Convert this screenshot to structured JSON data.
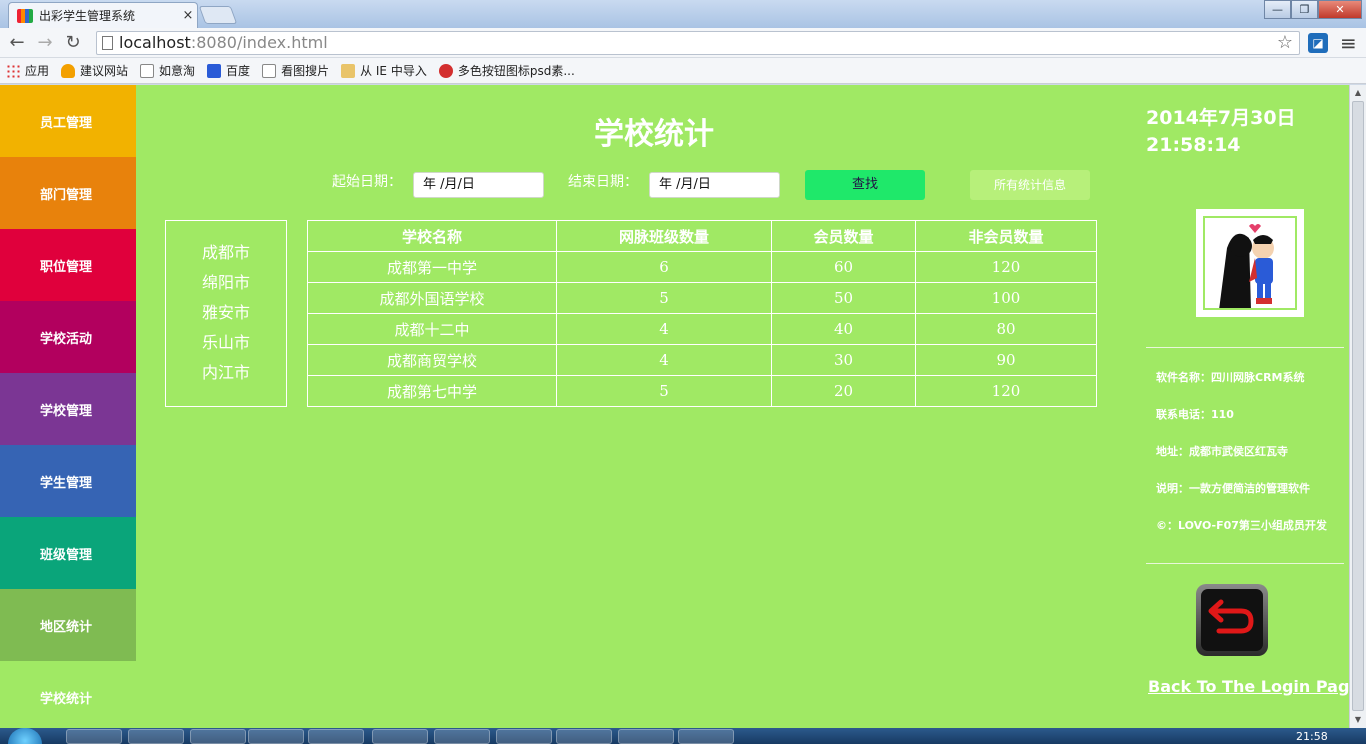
{
  "browser": {
    "tab_title": "出彩学生管理系统",
    "tab_close": "×",
    "url_host": "localhost",
    "url_path": ":8080/index.html",
    "window_controls": [
      "—",
      "❐",
      "✕"
    ]
  },
  "bookmarks": [
    {
      "label": "应用",
      "icon": "apps-icon"
    },
    {
      "label": "建议网站",
      "icon": "bulb-icon"
    },
    {
      "label": "如意淘",
      "icon": "page-icon"
    },
    {
      "label": "百度",
      "icon": "paw-icon"
    },
    {
      "label": "看图搜片",
      "icon": "page-icon"
    },
    {
      "label": "从 IE 中导入",
      "icon": "folder-icon"
    },
    {
      "label": "多色按钮图标psd素...",
      "icon": "red-badge-icon"
    }
  ],
  "sidebar": {
    "items": [
      {
        "label": "员工管理",
        "color": "#f2b200"
      },
      {
        "label": "部门管理",
        "color": "#e8820c"
      },
      {
        "label": "职位管理",
        "color": "#e0003c"
      },
      {
        "label": "学校活动",
        "color": "#b2005e"
      },
      {
        "label": "学校管理",
        "color": "#7b3694"
      },
      {
        "label": "学生管理",
        "color": "#3664b4"
      },
      {
        "label": "班级管理",
        "color": "#0aa57a"
      },
      {
        "label": "地区统计",
        "color": "#7fbb52"
      },
      {
        "label": "学校统计",
        "color": "#a0e964"
      }
    ]
  },
  "main": {
    "title": "学校统计",
    "start_label": "起始日期：",
    "start_value": "年 /月/日",
    "end_label": "结束日期：",
    "end_value": "年 /月/日",
    "search_button": "查找",
    "all_stats_button": "所有统计信息"
  },
  "cities": [
    "成都市",
    "绵阳市",
    "雅安市",
    "乐山市",
    "内江市"
  ],
  "table": {
    "headers": [
      "学校名称",
      "网脉班级数量",
      "会员数量",
      "非会员数量"
    ],
    "rows": [
      [
        "成都第一中学",
        "6",
        "60",
        "120"
      ],
      [
        "成都外国语学校",
        "5",
        "50",
        "100"
      ],
      [
        "成都十二中",
        "4",
        "40",
        "80"
      ],
      [
        "成都商贸学校",
        "4",
        "30",
        "90"
      ],
      [
        "成都第七中学",
        "5",
        "20",
        "120"
      ]
    ]
  },
  "right_panel": {
    "date": "2014年7月30日",
    "time": "21:58:14",
    "info": [
      "软件名称：四川网脉CRM系统",
      "联系电话：110",
      "地址：成都市武侯区红瓦寺",
      "说明：一款方便简洁的管理软件",
      "©：LOVO-F07第三小组成员开发"
    ],
    "back_link": "Back To The Login Page"
  },
  "taskbar": {
    "time": "21:58"
  },
  "colors": {
    "page_bg": "#a0e964",
    "search_button_bg": "#1fe86a",
    "all_button_bg": "#b7f07a"
  }
}
